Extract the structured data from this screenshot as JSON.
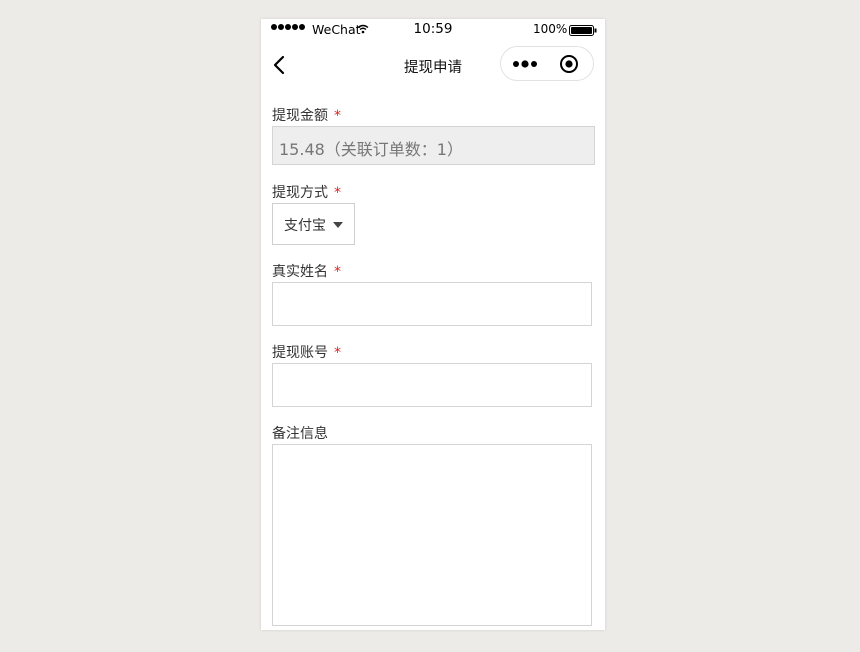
{
  "status_bar": {
    "carrier": "WeChat",
    "time": "10:59",
    "battery": "100%"
  },
  "nav": {
    "title": "提现申请"
  },
  "form": {
    "amount": {
      "label": "提现金额",
      "required_mark": "*",
      "value": "15.48（关联订单数：1）"
    },
    "method": {
      "label": "提现方式",
      "required_mark": "*",
      "selected": "支付宝"
    },
    "real_name": {
      "label": "真实姓名",
      "required_mark": "*",
      "value": ""
    },
    "account": {
      "label": "提现账号",
      "required_mark": "*",
      "value": ""
    },
    "remark": {
      "label": "备注信息",
      "value": ""
    }
  },
  "icons": [
    "signal-icon",
    "wifi-icon",
    "battery-icon",
    "back-icon",
    "more-icon",
    "close-miniprogram-icon",
    "chevron-down-icon"
  ]
}
